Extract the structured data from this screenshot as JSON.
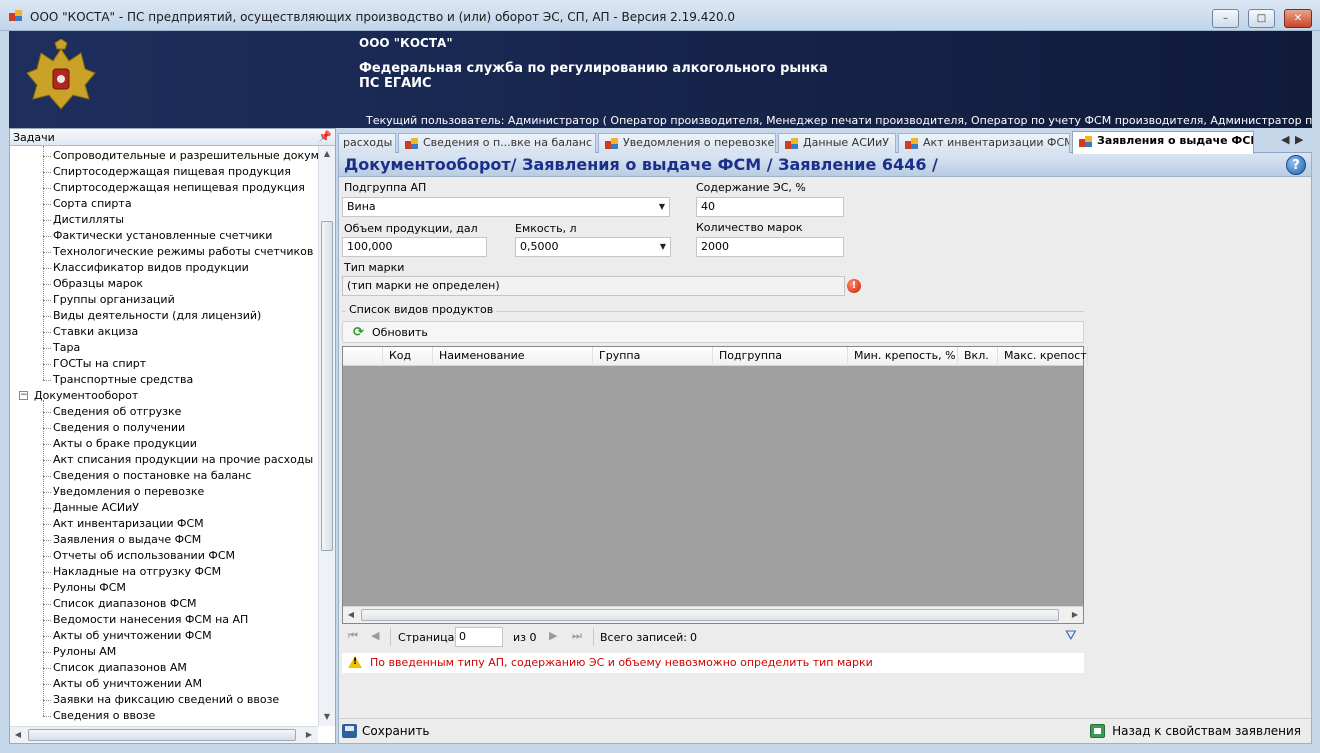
{
  "window": {
    "title": "ООО \"КОСТА\" - ПС предприятий, осуществляющих производство и (или) оборот ЭС, СП, АП - Версия 2.19.420.0",
    "minimize": "–",
    "maximize": "□",
    "close": "✕"
  },
  "banner": {
    "org_name": "ООО \"КОСТА\"",
    "agency_line1": "Федеральная служба по регулированию алкогольного рынка",
    "agency_line2": "ПС ЕГАИС",
    "current_user": "Текущий пользователь: Администратор ( Оператор производителя, Менеджер печати производителя, Оператор по учету ФСМ производителя, Администратор производителя, Опера..."
  },
  "left_panel": {
    "title": "Задачи",
    "pin": "ᵖ",
    "items_top": [
      "Сопроводительные и разрешительные документы",
      "Спиртосодержащая пищевая продукция",
      "Спиртосодержащая непищевая продукция",
      "Сорта спирта",
      "Дистилляты",
      "Фактически установленные счетчики",
      "Технологические режимы работы счетчиков",
      "Классификатор видов продукции",
      "Образцы марок",
      "Группы организаций",
      "Виды деятельности (для лицензий)",
      "Ставки акциза",
      "Тара",
      "ГОСТы на спирт",
      "Транспортные средства"
    ],
    "group_label": "Документооборот",
    "group_expander": "−",
    "items_docs": [
      "Сведения об отгрузке",
      "Сведения о получении",
      "Акты о браке продукции",
      "Акт списания продукции на прочие расходы",
      "Сведения о постановке на баланс",
      "Уведомления о перевозке",
      "Данные АСИиУ",
      "Акт инвентаризации ФСМ",
      "Заявления о выдаче ФСМ",
      "Отчеты об использовании ФСМ",
      "Накладные на отгрузку ФСМ",
      "Рулоны ФСМ",
      "Список диапазонов ФСМ",
      "Ведомости нанесения ФСМ на АП",
      "Акты об уничтожении ФСМ",
      "Рулоны АМ",
      "Список диапазонов АМ",
      "Акты об уничтожении АМ",
      "Заявки на фиксацию сведений о ввозе",
      "Сведения о ввозе"
    ]
  },
  "tabs": [
    {
      "label": "расходы",
      "icon": false
    },
    {
      "label": "Сведения о п...вке на баланс",
      "icon": true
    },
    {
      "label": "Уведомления о перевозке",
      "icon": true
    },
    {
      "label": "Данные АСИиУ",
      "icon": true
    },
    {
      "label": "Акт инвентаризации ФСМ",
      "icon": true
    },
    {
      "label": "Заявления о выдаче ФСМ",
      "icon": true,
      "active": true
    }
  ],
  "tab_nav": {
    "prev": "◀",
    "next": "▶"
  },
  "document": {
    "title": "Документооборот/ Заявления о выдаче ФСМ / Заявление 6446 /",
    "help": "?",
    "fields": {
      "subgroup_label": "Подгруппа АП",
      "subgroup_value": "Вина",
      "es_content_label": "Содержание ЭС, %",
      "es_content_value": "40",
      "volume_label": "Объем продукции, дал",
      "volume_value": "100,000",
      "capacity_label": "Емкость, л",
      "capacity_value": "0,5000",
      "marks_count_label": "Количество марок",
      "marks_count_value": "2000",
      "mark_type_label": "Тип марки",
      "mark_type_value": "(тип марки не определен)",
      "error_mark": "!"
    },
    "products": {
      "group_title": "Список видов продуктов",
      "refresh_label": "Обновить",
      "columns": [
        "Код",
        "Наименование",
        "Группа",
        "Подгруппа",
        "Мин. крепость, %",
        "Вкл.",
        "Макс. крепость"
      ],
      "rows": [],
      "pager": {
        "page_label": "Страница",
        "page_value": "0",
        "of_label": "из 0",
        "total_label": "Всего записей:",
        "total_value": "0"
      }
    },
    "warning": "По введенным типу АП, содержанию ЭС и объему невозможно определить тип марки",
    "save_label": "Сохранить",
    "back_label": "Назад к свойствам заявления"
  }
}
